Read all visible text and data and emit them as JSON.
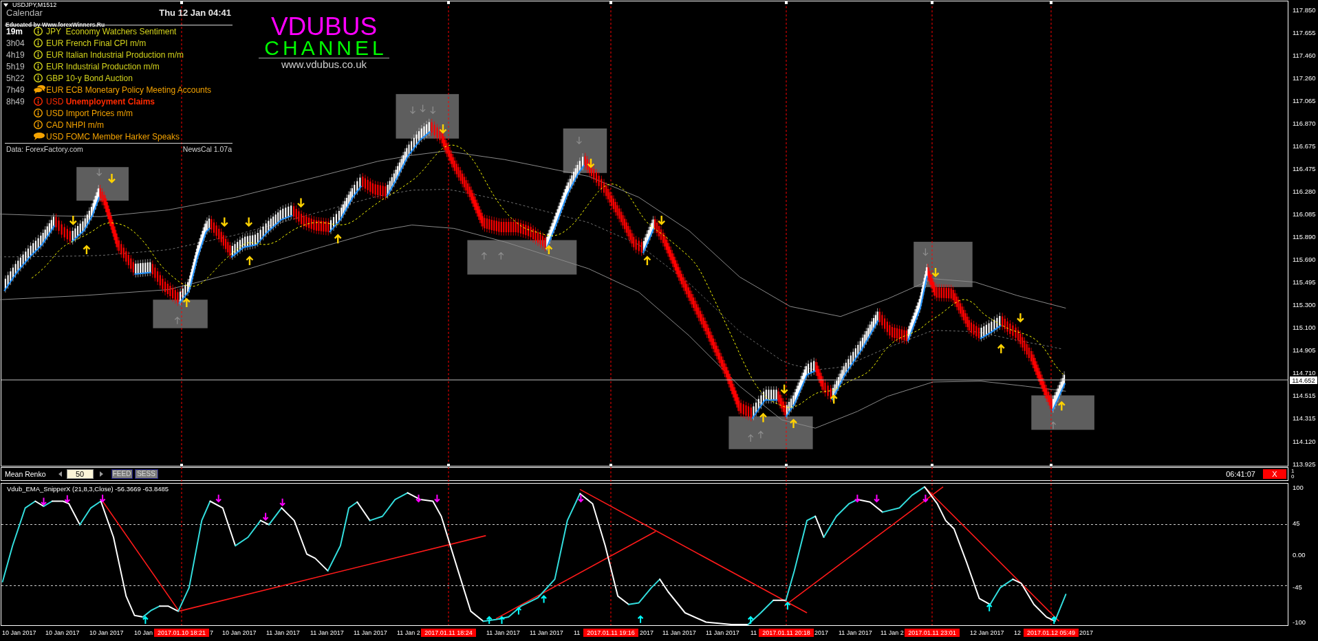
{
  "chart_header": {
    "symbol": "USDJPY,M1512",
    "credit": "Educated by Www.forexWinners.Ru"
  },
  "news_calendar": {
    "title": "Calendar",
    "clock": "Thu 12 Jan 04:41",
    "events": [
      {
        "time": "19m",
        "next": true,
        "kind": "info",
        "color": "#d4d41c",
        "event": "JPY  Economy Watchers Sentiment"
      },
      {
        "time": "3h04",
        "next": false,
        "kind": "info",
        "color": "#d4d41c",
        "event": "EUR French Final CPI m/m"
      },
      {
        "time": "4h19",
        "next": false,
        "kind": "info",
        "color": "#d4d41c",
        "event": "EUR Italian Industrial Production m/m"
      },
      {
        "time": "5h19",
        "next": false,
        "kind": "info",
        "color": "#d4d41c",
        "event": "EUR Industrial Production m/m"
      },
      {
        "time": "5h22",
        "next": false,
        "kind": "info",
        "color": "#d4d41c",
        "event": "GBP 10-y Bond Auction"
      },
      {
        "time": "7h49",
        "next": false,
        "kind": "speeches",
        "color": "#f5a300",
        "event": "EUR ECB Monetary Policy Meeting Accounts"
      },
      {
        "time": "8h49",
        "next": false,
        "kind": "info",
        "color": "#ff2a00",
        "event": "USD **Unemployment Claims**"
      },
      {
        "kind": "info",
        "color": "#f5a300",
        "event": "USD Import Prices m/m"
      },
      {
        "kind": "info",
        "color": "#f5a300",
        "event": "CAD NHPI m/m"
      },
      {
        "kind": "speech",
        "color": "#f5a300",
        "event": "USD FOMC Member Harker Speaks"
      }
    ],
    "source": "Data: ForexFactory.com",
    "version": "NewsCal 1.07a"
  },
  "logo": {
    "name": "VDUBUS",
    "subtitle": "CHANNEL",
    "url": "www.vdubus.co.uk"
  },
  "price_axis": {
    "labels": [
      "117.850",
      "117.655",
      "117.460",
      "117.260",
      "117.065",
      "116.870",
      "116.675",
      "116.475",
      "116.280",
      "116.085",
      "115.890",
      "115.690",
      "115.495",
      "115.300",
      "115.100",
      "114.905",
      "114.710",
      "114.515",
      "114.315",
      "114.120",
      "113.925"
    ],
    "current_price": "114.652"
  },
  "renko_panel": {
    "label": "Mean Renko",
    "brick_size": "50",
    "buttons": [
      "FEED",
      "SESS"
    ],
    "timer": "06:41:07",
    "close_button": "X",
    "axis_labels": [
      "1",
      "0"
    ]
  },
  "indicator": {
    "title": "Vdub_EMA_SnipperX (21,8,3,Close) -56.3669 -63.8485",
    "axis_labels": [
      "100",
      "45",
      "0.00",
      "-45",
      "-100"
    ]
  },
  "time_axis": {
    "labels": [
      "10 Jan 2017",
      "10 Jan 2017",
      "10 Jan 2017",
      "10 Jan",
      "7",
      "10 Jan 2017",
      "11 Jan 2017",
      "11 Jan 2017",
      "11 Jan 2017",
      "11 Jan 2",
      "11 Jan 2017",
      "11 Jan 2017",
      "11",
      "2017",
      "11 Jan 2017",
      "11 Jan 2017",
      "11",
      "2017",
      "11 Jan 2017",
      "11 Jan 2",
      "12 Jan 2017",
      "12",
      "2017"
    ],
    "markers": [
      "2017.01.10 18:21",
      "2017.01.11 18:24",
      "2017.01.11 19:16",
      "2017.01.11 20:18",
      "2017.01.11 23:01",
      "2017.01.12 05:49"
    ]
  }
}
